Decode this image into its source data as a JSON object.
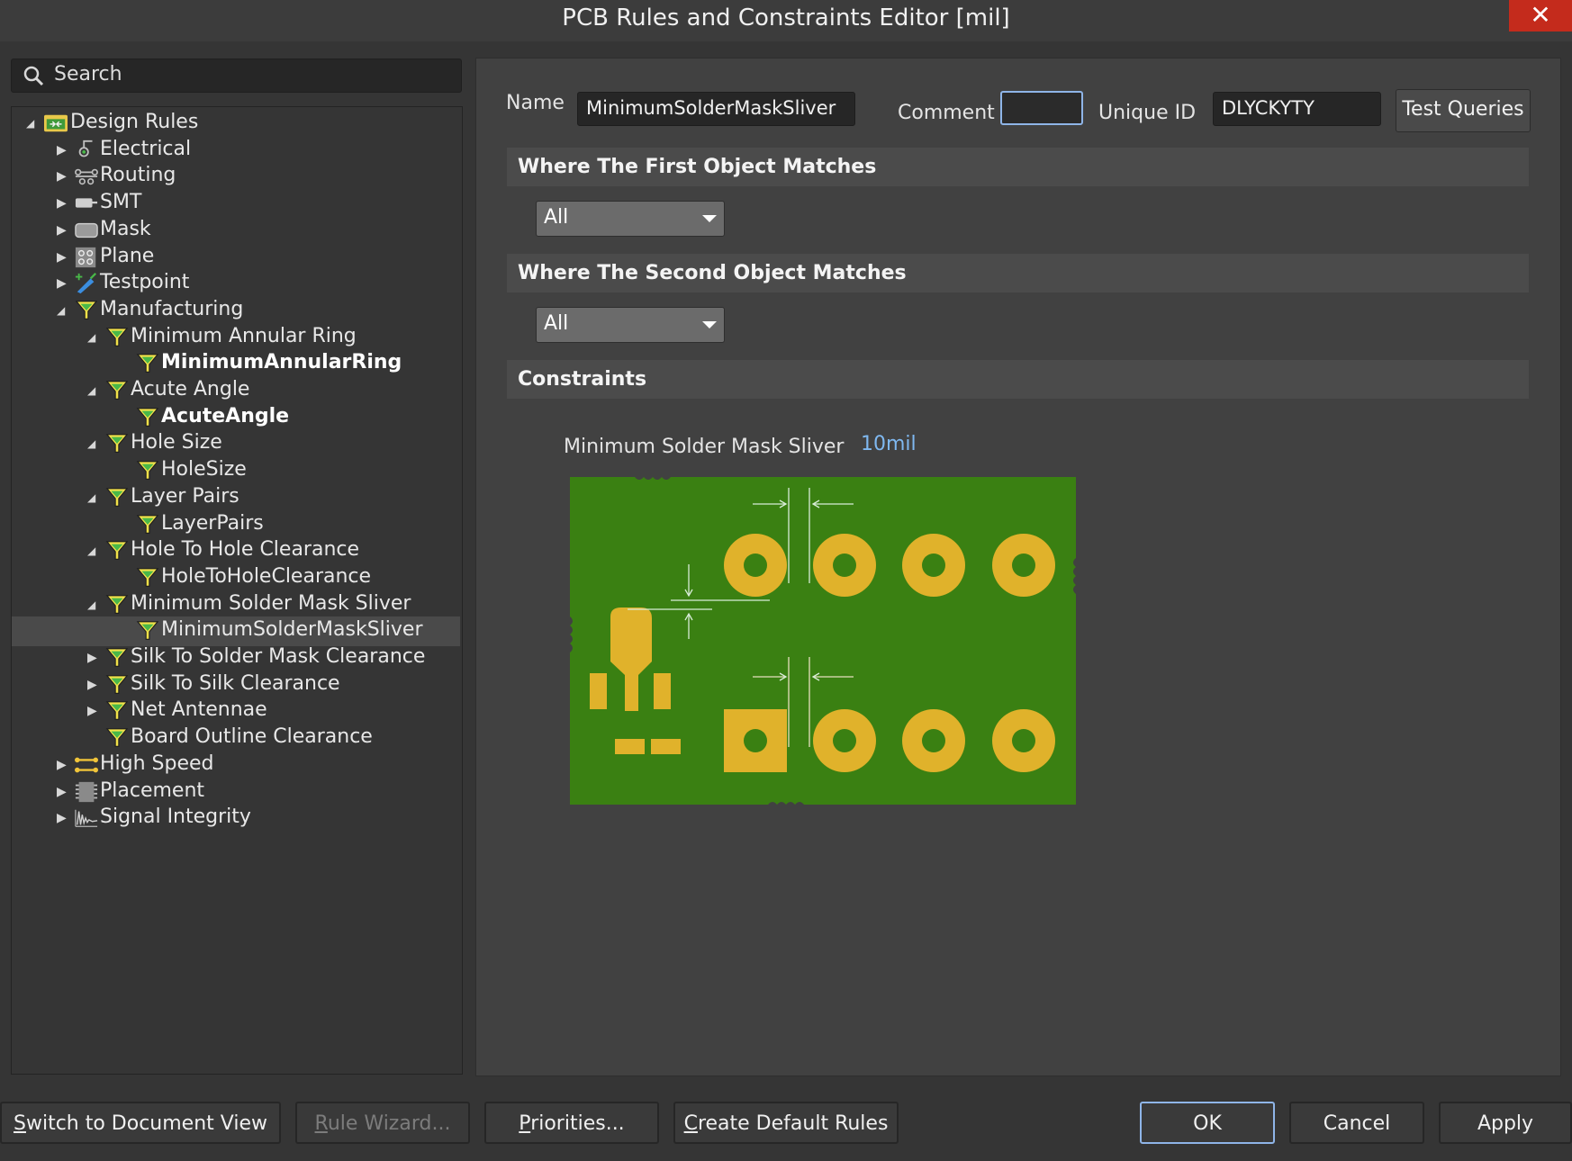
{
  "window": {
    "title": "PCB Rules and Constraints Editor [mil]",
    "close_glyph": "✕"
  },
  "search": {
    "label": "Search",
    "icon": "search-icon"
  },
  "tree": [
    {
      "label": "Design Rules",
      "level": 0,
      "expanded": true,
      "icon": "design-rules-icon"
    },
    {
      "label": "Electrical",
      "level": 1,
      "expanded": false,
      "icon": "electrical-icon"
    },
    {
      "label": "Routing",
      "level": 1,
      "expanded": false,
      "icon": "routing-icon"
    },
    {
      "label": "SMT",
      "level": 1,
      "expanded": false,
      "icon": "smt-icon"
    },
    {
      "label": "Mask",
      "level": 1,
      "expanded": false,
      "icon": "mask-icon"
    },
    {
      "label": "Plane",
      "level": 1,
      "expanded": false,
      "icon": "plane-icon"
    },
    {
      "label": "Testpoint",
      "level": 1,
      "expanded": false,
      "icon": "testpoint-icon"
    },
    {
      "label": "Manufacturing",
      "level": 1,
      "expanded": true,
      "icon": "rule-funnel-icon"
    },
    {
      "label": "Minimum Annular Ring",
      "level": 2,
      "expanded": true,
      "icon": "rule-funnel-icon"
    },
    {
      "label": "MinimumAnnularRing",
      "level": 3,
      "bold": true,
      "icon": "rule-funnel-icon"
    },
    {
      "label": "Acute Angle",
      "level": 2,
      "expanded": true,
      "icon": "rule-funnel-icon"
    },
    {
      "label": "AcuteAngle",
      "level": 3,
      "bold": true,
      "icon": "rule-funnel-icon"
    },
    {
      "label": "Hole Size",
      "level": 2,
      "expanded": true,
      "icon": "rule-funnel-icon"
    },
    {
      "label": "HoleSize",
      "level": 3,
      "icon": "rule-funnel-icon"
    },
    {
      "label": "Layer Pairs",
      "level": 2,
      "expanded": true,
      "icon": "rule-funnel-icon"
    },
    {
      "label": "LayerPairs",
      "level": 3,
      "icon": "rule-funnel-icon"
    },
    {
      "label": "Hole To Hole Clearance",
      "level": 2,
      "expanded": true,
      "icon": "rule-funnel-icon"
    },
    {
      "label": "HoleToHoleClearance",
      "level": 3,
      "icon": "rule-funnel-icon"
    },
    {
      "label": "Minimum Solder Mask Sliver",
      "level": 2,
      "expanded": true,
      "icon": "rule-funnel-icon"
    },
    {
      "label": "MinimumSolderMaskSliver",
      "level": 3,
      "selected": true,
      "icon": "rule-funnel-icon"
    },
    {
      "label": "Silk To Solder Mask Clearance",
      "level": 2,
      "expanded": false,
      "icon": "rule-funnel-icon"
    },
    {
      "label": "Silk To Silk Clearance",
      "level": 2,
      "expanded": false,
      "icon": "rule-funnel-icon"
    },
    {
      "label": "Net Antennae",
      "level": 2,
      "expanded": false,
      "icon": "rule-funnel-icon"
    },
    {
      "label": "Board Outline Clearance",
      "level": 2,
      "icon": "rule-funnel-icon"
    },
    {
      "label": "High Speed",
      "level": 1,
      "expanded": false,
      "icon": "high-speed-icon"
    },
    {
      "label": "Placement",
      "level": 1,
      "expanded": false,
      "icon": "placement-icon"
    },
    {
      "label": "Signal Integrity",
      "level": 1,
      "expanded": false,
      "icon": "signal-integrity-icon"
    }
  ],
  "rule": {
    "name_label": "Name",
    "name_value": "MinimumSolderMaskSliver",
    "comment_label": "Comment",
    "comment_value": "",
    "unique_id_label": "Unique ID",
    "unique_id_value": "DLYCKYTY",
    "test_queries": "Test Queries"
  },
  "sections": {
    "first": "Where The First Object Matches",
    "first_value": "All",
    "second": "Where The Second Object Matches",
    "second_value": "All",
    "constraints": "Constraints"
  },
  "constraint": {
    "label": "Minimum Solder Mask Sliver",
    "value": "10mil"
  },
  "buttons": {
    "switch_view": {
      "mn": "S",
      "rest": "witch to Document View"
    },
    "rule_wizard": {
      "mn": "R",
      "rest": "ule Wizard..."
    },
    "priorities": {
      "mn": "P",
      "rest": "riorities..."
    },
    "create_default": {
      "mn": "C",
      "rest": "reate Default Rules"
    },
    "ok": "OK",
    "cancel": "Cancel",
    "apply": "Apply"
  },
  "colors": {
    "board_green": "#3a8012",
    "pad_gold": "#e0b22b",
    "dimension_lines": "#d8ecd8",
    "value_link": "#7fb8f0",
    "focus_border": "#8fb5e8"
  }
}
